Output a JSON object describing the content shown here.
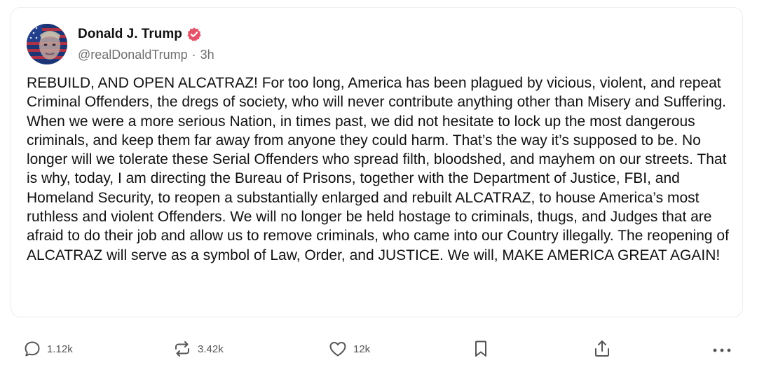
{
  "post": {
    "author": {
      "display_name": "Donald J. Trump",
      "handle": "@realDonaldTrump",
      "separator": "·",
      "time": "3h",
      "verified_color": "#e3546a"
    },
    "text": "REBUILD, AND OPEN ALCATRAZ! For too long, America has been plagued by vicious, violent, and repeat Criminal Offenders, the dregs of society, who will never contribute anything other than Misery and Suffering. When we were a more serious Nation, in times past, we did not hesitate to lock up the most dangerous criminals, and keep them far away from anyone they could harm. That’s the way it’s supposed to be. No longer will we tolerate these Serial Offenders who spread filth, bloodshed, and mayhem on our streets. That is why, today, I am directing the Bureau of Prisons, together with the Department of Justice, FBI, and Homeland Security, to reopen a substantially enlarged and rebuilt ALCATRAZ, to house America’s most ruthless and violent Offenders. We will no longer be held hostage to criminals, thugs, and Judges that are afraid to do their job and allow us to remove criminals, who came into our Country illegally. The reopening of ALCATRAZ will serve as a symbol of Law, Order, and JUSTICE. We will, MAKE AMERICA GREAT AGAIN!"
  },
  "actions": {
    "reply_count": "1.12k",
    "retruth_count": "3.42k",
    "like_count": "12k",
    "icons": [
      "reply-icon",
      "retruth-icon",
      "like-icon",
      "bookmark-icon",
      "share-icon",
      "more-icon"
    ]
  }
}
